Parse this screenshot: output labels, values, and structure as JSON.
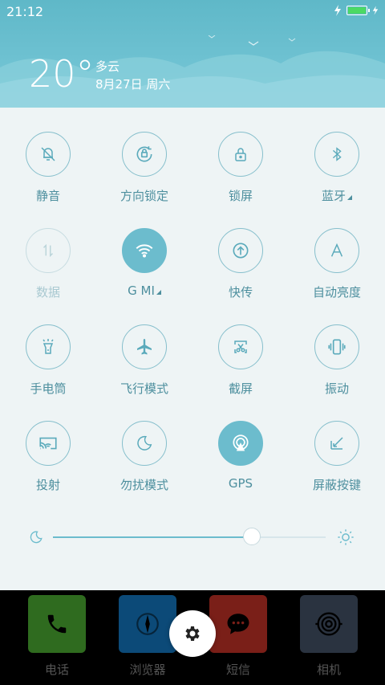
{
  "status_bar": {
    "time": "21:12"
  },
  "weather": {
    "temperature": "20°",
    "condition": "多云",
    "date": "8月27日 周六"
  },
  "toggles": [
    {
      "label": "静音",
      "icon": "bell-off-icon",
      "state": "off"
    },
    {
      "label": "方向锁定",
      "icon": "rotation-lock-icon",
      "state": "off"
    },
    {
      "label": "锁屏",
      "icon": "lock-icon",
      "state": "off"
    },
    {
      "label": "蓝牙",
      "icon": "bluetooth-icon",
      "state": "off",
      "has_menu": true
    },
    {
      "label": "数据",
      "icon": "data-arrows-icon",
      "state": "disabled"
    },
    {
      "label": "G MI",
      "icon": "wifi-icon",
      "state": "on",
      "has_menu": true
    },
    {
      "label": "快传",
      "icon": "upload-circle-icon",
      "state": "off"
    },
    {
      "label": "自动亮度",
      "icon": "auto-brightness-icon",
      "state": "off"
    },
    {
      "label": "手电筒",
      "icon": "flashlight-icon",
      "state": "off"
    },
    {
      "label": "飞行模式",
      "icon": "airplane-icon",
      "state": "off"
    },
    {
      "label": "截屏",
      "icon": "screenshot-scissors-icon",
      "state": "off"
    },
    {
      "label": "振动",
      "icon": "vibrate-icon",
      "state": "off"
    },
    {
      "label": "投射",
      "icon": "cast-icon",
      "state": "off"
    },
    {
      "label": "勿扰模式",
      "icon": "moon-icon",
      "state": "off"
    },
    {
      "label": "GPS",
      "icon": "gps-icon",
      "state": "on"
    },
    {
      "label": "屏蔽按键",
      "icon": "block-keys-icon",
      "state": "off"
    }
  ],
  "brightness": {
    "level": 0.73
  },
  "dock": [
    {
      "label": "电话",
      "icon": "phone-icon",
      "color": "#2f6b1f"
    },
    {
      "label": "浏览器",
      "icon": "compass-icon",
      "color": "#0c4a78"
    },
    {
      "label": "短信",
      "icon": "message-icon",
      "color": "#7a1f18"
    },
    {
      "label": "相机",
      "icon": "camera-icon",
      "color": "#2a3340"
    }
  ],
  "colors": {
    "accent": "#6cbccd",
    "panel": "#eef4f5",
    "header": "#6fc2d2"
  }
}
